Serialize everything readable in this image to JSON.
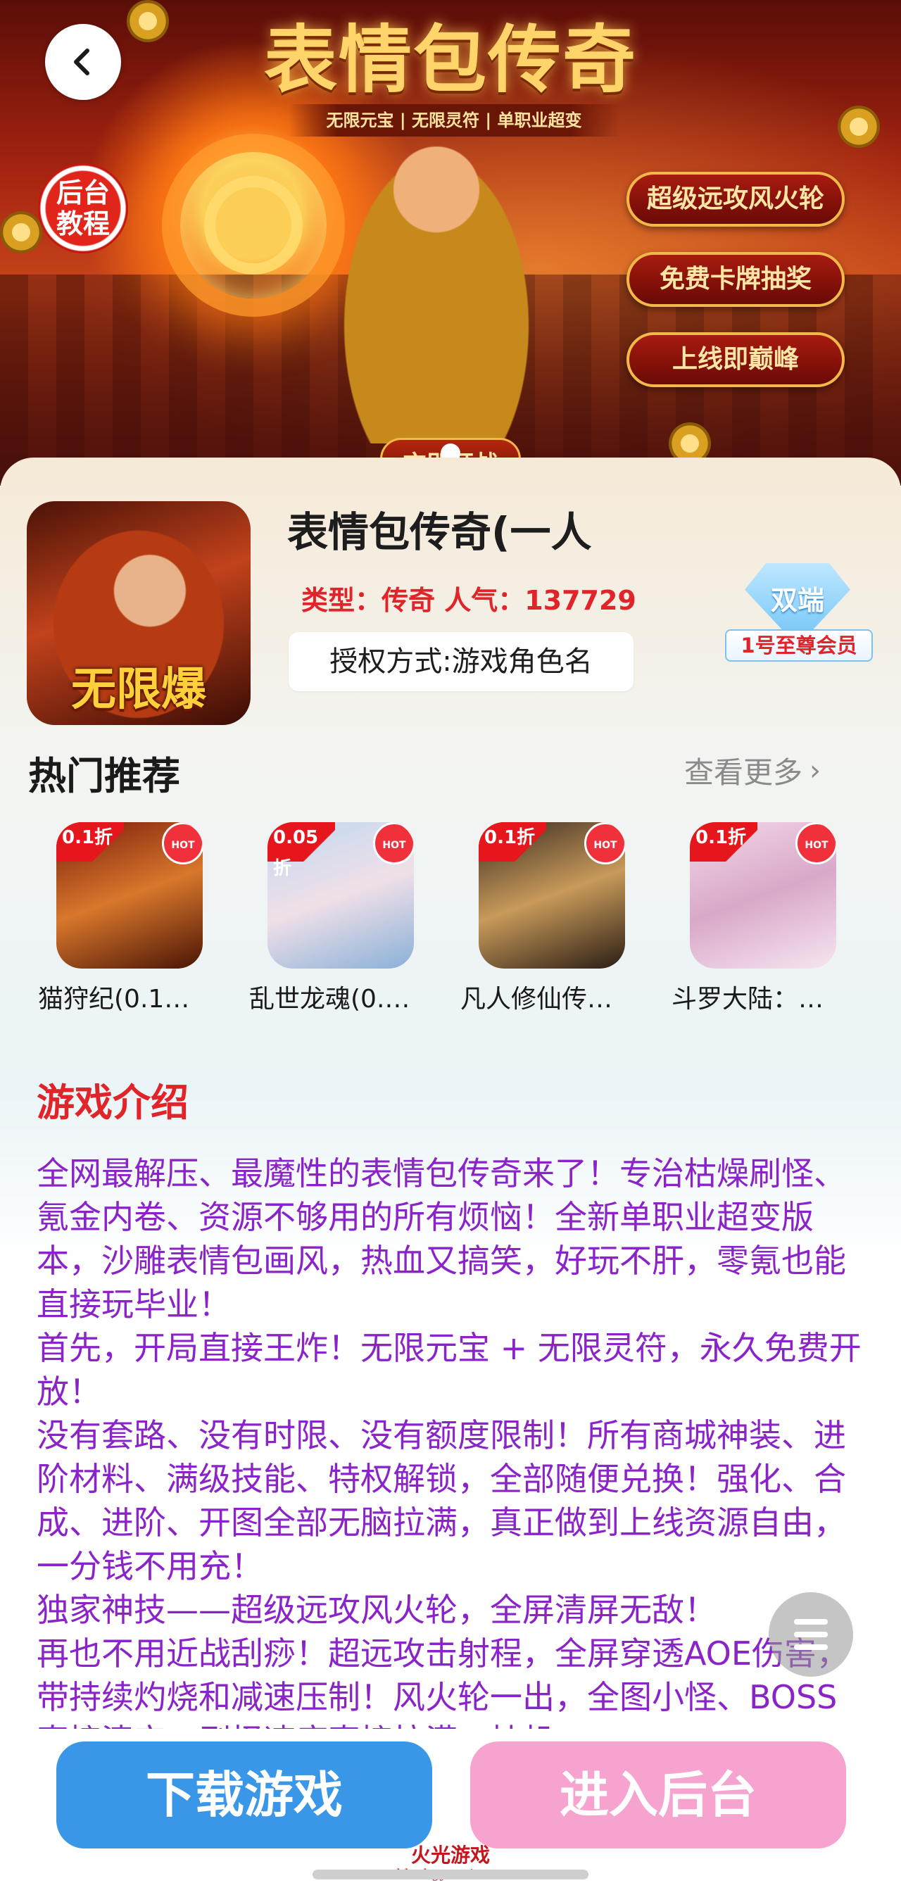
{
  "hero": {
    "title": "表情包传奇",
    "subtitle": "无限元宝 | 无限灵符 | 单职业超变",
    "badges": [
      "超级远攻风火轮",
      "免费卡牌抽奖",
      "上线即巅峰"
    ],
    "tutorial_line1": "后台",
    "tutorial_line2": "教程",
    "bottom_text": "充即开战"
  },
  "game": {
    "icon_caption": "无限爆",
    "title": "表情包传奇(一人",
    "meta": "类型：传奇 人气：137729",
    "auth": "授权方式:游戏角色名",
    "vip_badge_top": "双端",
    "vip_badge_bottom": "1号至尊会员"
  },
  "recommend": {
    "title": "热门推荐",
    "see_more": "查看更多",
    "items": [
      {
        "name": "猫狩纪(0.1…",
        "discount": "0.1折",
        "hot": "HOT",
        "bg": "linear-gradient(160deg,#7a1d0c,#d8772c 50%,#4a1405)"
      },
      {
        "name": "乱世龙魂(0.…",
        "discount": "0.05折",
        "hot": "HOT",
        "bg": "linear-gradient(160deg,#bfd8f0,#f0e0e8 50%,#8ab0d8)"
      },
      {
        "name": "凡人修仙传…",
        "discount": "0.1折",
        "hot": "HOT",
        "bg": "linear-gradient(160deg,#3a2c22,#c89a5a 50%,#2a1d14)"
      },
      {
        "name": "斗罗大陆：…",
        "discount": "0.1折",
        "hot": "HOT",
        "bg": "linear-gradient(160deg,#f2d8e8,#d9a8c8 50%,#f6e6f0)"
      }
    ]
  },
  "intro": {
    "title": "游戏介绍",
    "paragraphs": [
      "全网最解压、最魔性的表情包传奇来了！专治枯燥刷怪、氪金内卷、资源不够用的所有烦恼！全新单职业超变版本，沙雕表情包画风，热血又搞笑，好玩不肝，零氪也能直接玩毕业！",
      "首先，开局直接王炸！无限元宝 + 无限灵符，永久免费开放！",
      "没有套路、没有时限、没有额度限制！所有商城神装、进阶材料、满级技能、特权解锁，全部随便兑换！强化、合成、进阶、开图全部无脑拉满，真正做到上线资源自由，一分钱不用充！",
      "独家神技——超级远攻风火轮，全屏清屏无敌！",
      "再也不用近战刮痧！超远攻击射程，全屏穿透AOE伤害，带持续灼烧和减速压制！风火轮一出，全图小怪、BOSS直接清空，刷怪速度直接拉满，挂机"
    ]
  },
  "actions": {
    "download": "下载游戏",
    "admin": "进入后台"
  },
  "watermark": {
    "line1": "火光游戏",
    "line2": "bbs.hgyouxi.com"
  },
  "colors": {
    "accent_red": "#e0242a",
    "intro_purple": "#8b24c8",
    "download_blue": "#3a96e6",
    "admin_pink": "#f7a3cf"
  }
}
